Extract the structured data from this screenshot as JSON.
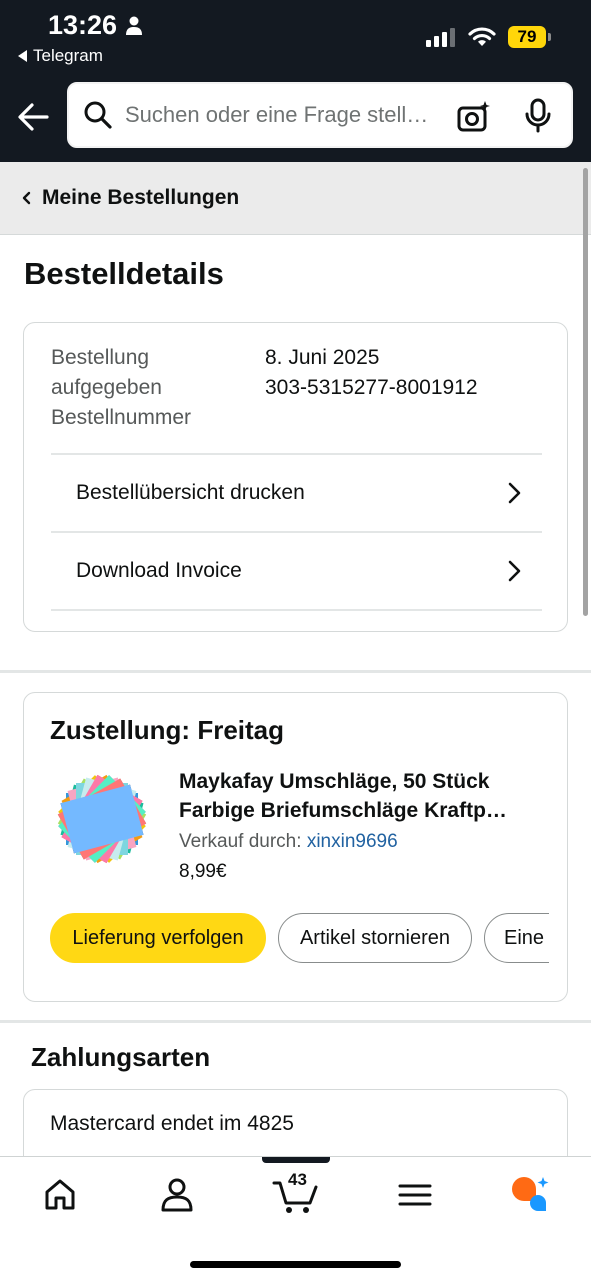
{
  "status_bar": {
    "time": "13:26",
    "back_app": "Telegram",
    "battery": "79"
  },
  "search": {
    "placeholder": "Suchen oder eine Frage stell…"
  },
  "breadcrumb": {
    "label": "Meine Bestellungen"
  },
  "page": {
    "title": "Bestelldetails"
  },
  "order": {
    "labels": [
      "Bestellung",
      "aufgegeben",
      "Bestellnummer"
    ],
    "date": "8. Juni 2025",
    "number": "303-5315277-8001912",
    "actions": [
      {
        "label": "Bestellübersicht drucken"
      },
      {
        "label": "Download Invoice"
      }
    ]
  },
  "delivery": {
    "title": "Zustellung: Freitag",
    "product": {
      "title_line1": "Maykafay Umschläge, 50 Stück",
      "title_line2": "Farbige Briefumschläge Kraftp…",
      "seller_prefix": "Verkauf durch:",
      "seller": "xinxin9696",
      "price": "8,99€"
    },
    "buttons": {
      "track": "Lieferung verfolgen",
      "cancel": "Artikel stornieren",
      "more": "Eine"
    }
  },
  "payment": {
    "title": "Zahlungsarten",
    "method": "Mastercard  endet im 4825"
  },
  "bottom_nav": {
    "cart_count": "43",
    "items": [
      "home-icon",
      "account-icon",
      "cart-icon",
      "menu-icon",
      "rufus-icon"
    ]
  },
  "colors": {
    "header_bg": "#131921",
    "primary_button": "#ffd814",
    "link": "#2162a1",
    "battery": "#ffd60a",
    "rufus_orange": "#ff6a14",
    "rufus_blue": "#1a98ff"
  }
}
